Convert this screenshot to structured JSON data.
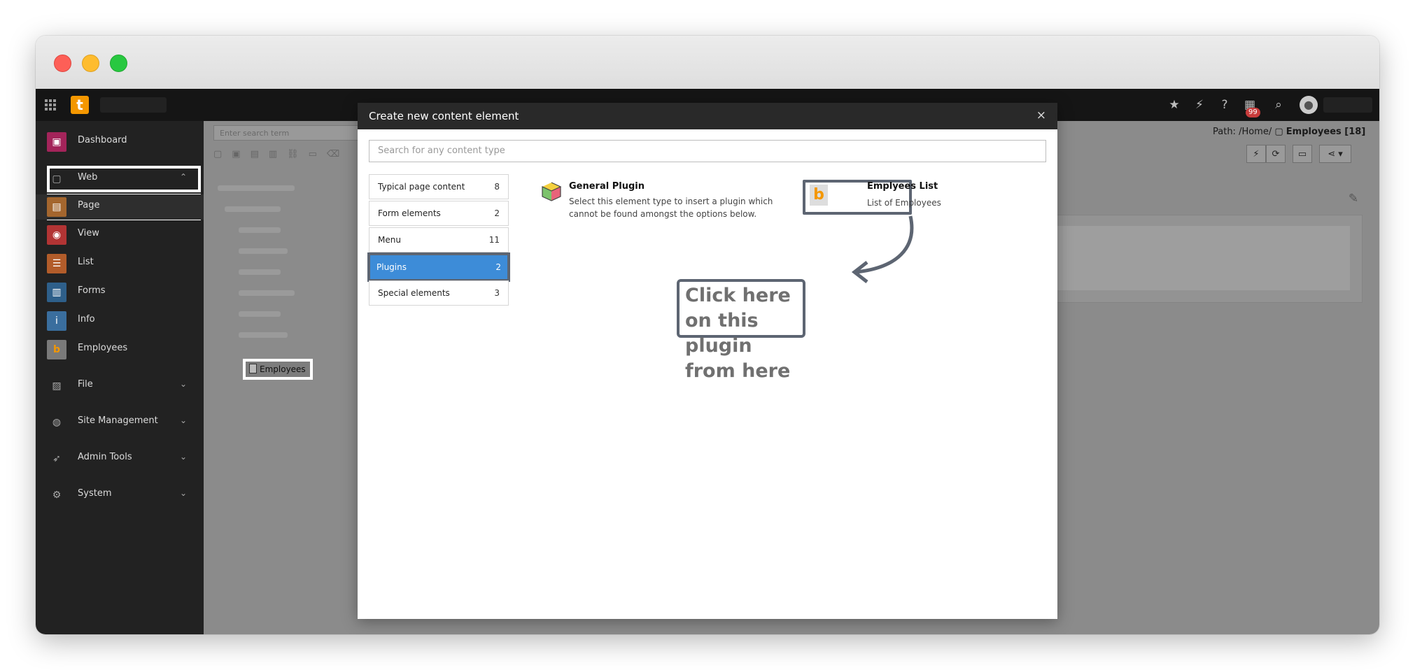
{
  "topbar": {
    "notification_count": "99"
  },
  "sidebar": {
    "dashboard": "Dashboard",
    "web": "Web",
    "page": "Page",
    "view": "View",
    "list": "List",
    "forms": "Forms",
    "info": "Info",
    "employees": "Employees",
    "file": "File",
    "site_management": "Site Management",
    "admin_tools": "Admin Tools",
    "system": "System"
  },
  "content": {
    "search_placeholder": "Enter search term",
    "path_label": "Path: /Home/",
    "path_current": "Employees [18]",
    "tree_node": "Employees"
  },
  "modal": {
    "title": "Create new content element",
    "close": "×",
    "search_placeholder": "Search for any content type",
    "categories": [
      {
        "label": "Typical page content",
        "count": "8"
      },
      {
        "label": "Form elements",
        "count": "2"
      },
      {
        "label": "Menu",
        "count": "11"
      },
      {
        "label": "Plugins",
        "count": "2"
      },
      {
        "label": "Special elements",
        "count": "3"
      }
    ],
    "items": [
      {
        "title": "General Plugin",
        "desc": "Select this element type to insert a plugin which cannot be found amongst the options below."
      },
      {
        "title": "Emplyees List",
        "desc": "List of Employees"
      }
    ],
    "callout": "Click here on this plugin from here"
  },
  "colors": {
    "active_category": "#3d8cd8",
    "highlight_border": "#5d6572",
    "sidebar_bg": "#222222"
  }
}
